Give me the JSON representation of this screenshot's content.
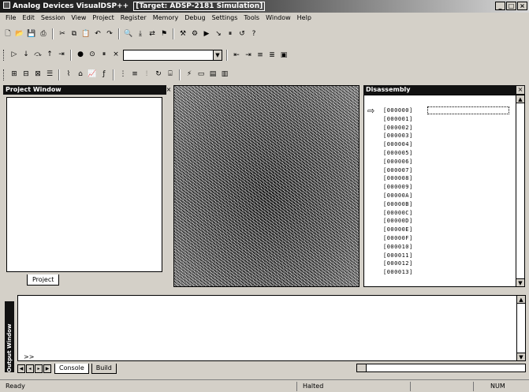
{
  "window": {
    "title": "Analog Devices VisualDSP++",
    "target": "[Target: ADSP-2181 Simulation]",
    "buttons": [
      "_",
      "□",
      "×"
    ]
  },
  "menu": [
    "File",
    "Edit",
    "Session",
    "View",
    "Project",
    "Register",
    "Memory",
    "Debug",
    "Settings",
    "Tools",
    "Window",
    "Help"
  ],
  "toolbar1": {
    "icons": [
      "new-file-icon",
      "open-icon",
      "save-icon",
      "print-icon",
      "cut-icon",
      "copy-icon",
      "paste-icon",
      "undo-icon",
      "redo-icon",
      "find-icon",
      "find-next-icon",
      "replace-icon",
      "bookmark-icon",
      "build-icon",
      "rebuild-icon",
      "run-icon",
      "step-icon",
      "halt-icon",
      "reset-icon",
      "help-icon"
    ],
    "glyphs": [
      "🗋",
      "📂",
      "💾",
      "⎙",
      "✂",
      "⧉",
      "📋",
      "↶",
      "↷",
      "🔍",
      "⤓",
      "⇄",
      "⚑",
      "⚒",
      "⚙",
      "▶",
      "↘",
      "⏸",
      "↺",
      "?"
    ]
  },
  "toolbar2": {
    "icons": [
      "debug-run-icon",
      "step-into-icon",
      "step-over-icon",
      "step-out-icon",
      "run-to-cursor-icon",
      "breakpoint-icon",
      "watch-icon",
      "halt-icon",
      "reset-target-icon"
    ],
    "glyphs": [
      "▷",
      "↓",
      "⤼",
      "↑",
      "⇥",
      "●",
      "⊙",
      "⏸",
      "×"
    ],
    "combo_value": "",
    "icons2": [
      "indent-icon",
      "outdent-icon",
      "comment-icon",
      "uncomment-icon",
      "window-icon"
    ],
    "glyphs2": [
      "⇤",
      "⇥",
      "≡",
      "≣",
      "▣"
    ]
  },
  "toolbar3": {
    "icons": [
      "register-icon",
      "memory-icon",
      "stack-icon",
      "disassembly-icon",
      "trace-icon",
      "profile-icon",
      "plot-icon",
      "expression-icon",
      "locals-icon",
      "call-stack-icon",
      "pipeline-icon",
      "cycle-icon",
      "cache-icon",
      "interrupt-icon",
      "output-icon",
      "chart-icon",
      "graph-icon"
    ],
    "glyphs": [
      "⊞",
      "⊟",
      "⊠",
      "☰",
      "⌇",
      "⌂",
      "📈",
      "ƒ",
      "⋮",
      "≡",
      "⫶",
      "↻",
      "⌸",
      "⚡",
      "▭",
      "▤",
      "▥"
    ]
  },
  "project_panel": {
    "title": "Project Window",
    "tab": "Project"
  },
  "disassembly_panel": {
    "title": "Disassembly",
    "addresses": [
      "[000000]",
      "[000001]",
      "[000002]",
      "[000003]",
      "[000004]",
      "[000005]",
      "[000006]",
      "[000007]",
      "[000008]",
      "[000009]",
      "[00000A]",
      "[00000B]",
      "[00000C]",
      "[00000D]",
      "[00000E]",
      "[00000F]",
      "[000010]",
      "[000011]",
      "[000012]",
      "[000013]"
    ]
  },
  "output_panel": {
    "title": "Output Window",
    "prompt": ">>",
    "tabs": [
      "Console",
      "Build"
    ]
  },
  "status": {
    "left": "Ready",
    "center": "Halted",
    "right": "NUM"
  }
}
